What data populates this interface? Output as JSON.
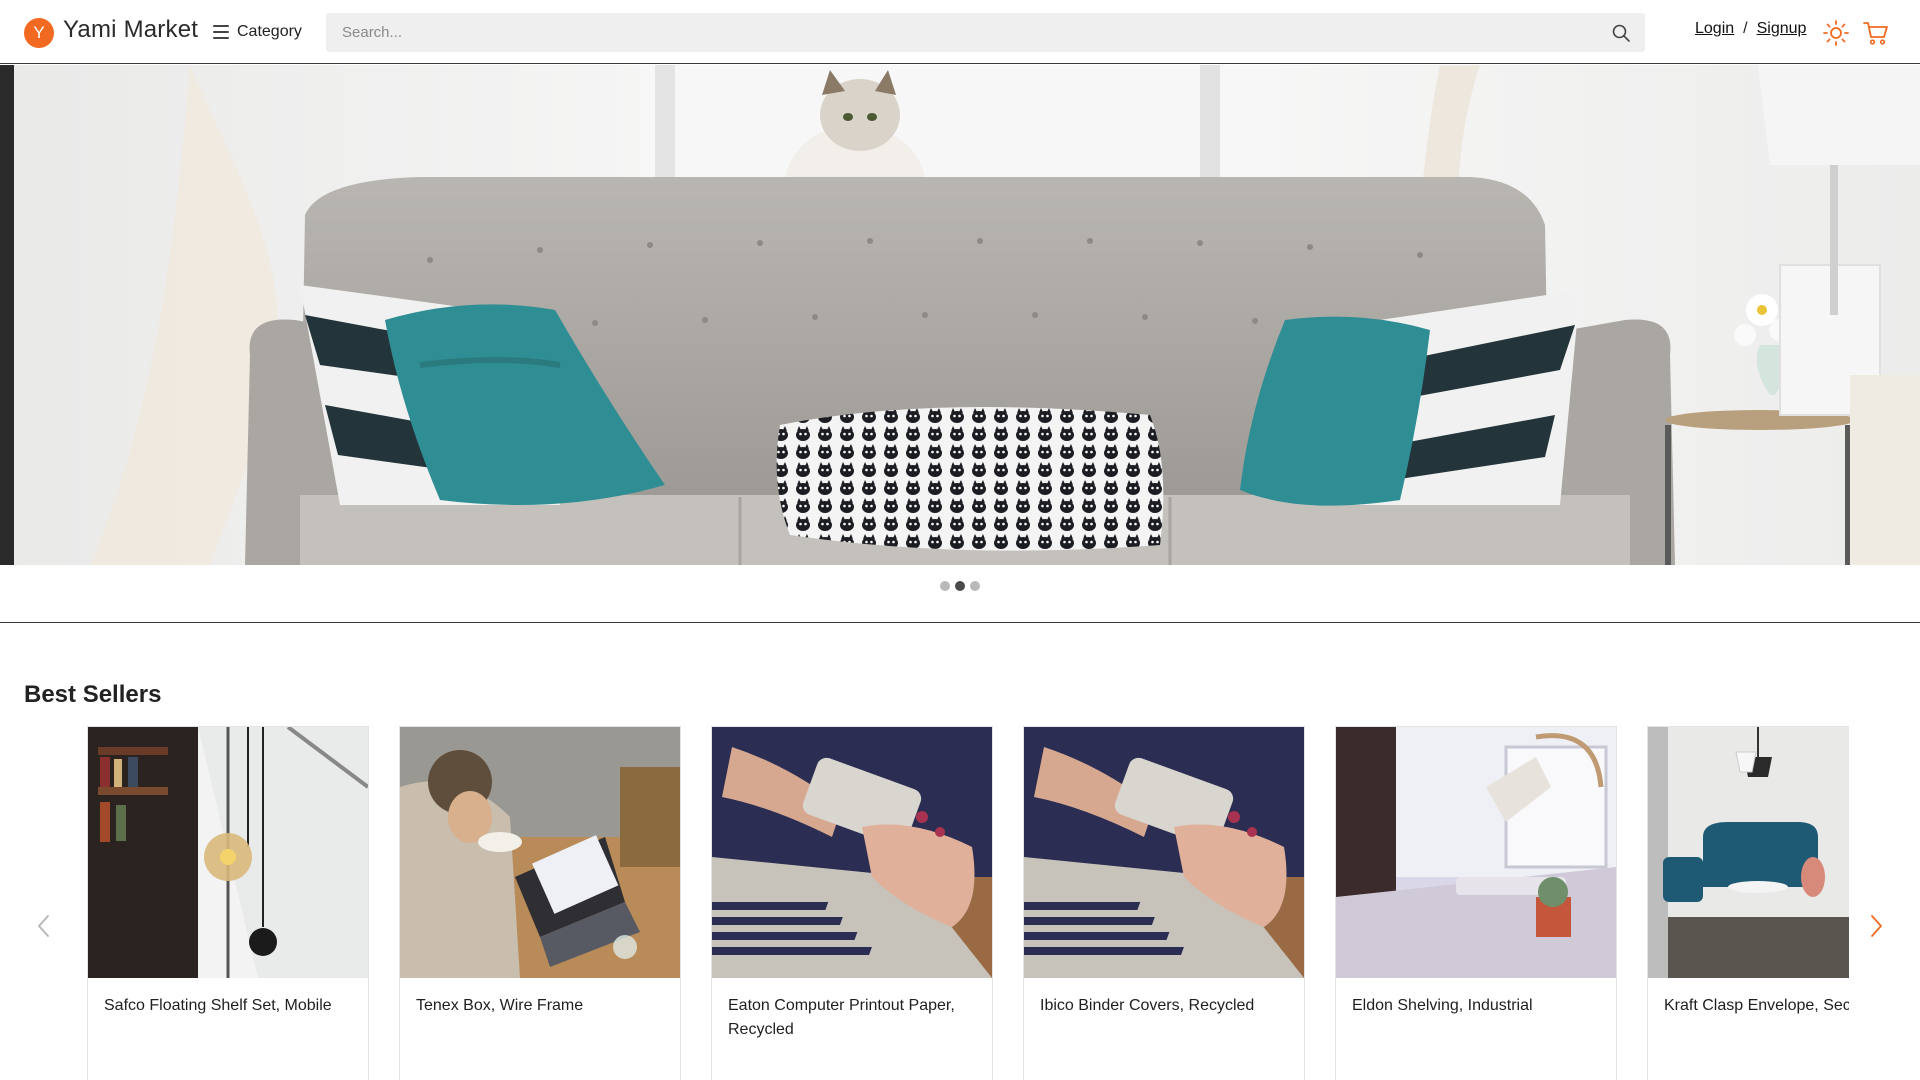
{
  "header": {
    "logo_letter": "Y",
    "brand": "Yami Market",
    "category_label": "Category",
    "search_placeholder": "Search...",
    "login_label": "Login",
    "separator": "/",
    "signup_label": "Signup",
    "icons": {
      "logo": "logo-badge",
      "category": "hamburger-menu-icon",
      "search": "search-icon",
      "theme": "sun-icon",
      "cart": "cart-icon"
    },
    "colors": {
      "accent": "#f26a21"
    }
  },
  "hero": {
    "image": "living room with grey tufted sofa, teal and striped pillows, cat in window",
    "slides": 3,
    "active_slide": 2
  },
  "best_sellers": {
    "title": "Best Sellers",
    "prev_icon": "chevron-left-icon",
    "next_icon": "chevron-right-icon",
    "products": [
      {
        "name": "Safco Floating Shelf Set, Mobile"
      },
      {
        "name": "Tenex Box, Wire Frame"
      },
      {
        "name": "Eaton Computer Printout Paper, Recycled"
      },
      {
        "name": "Ibico Binder Covers, Recycled"
      },
      {
        "name": "Eldon Shelving, Industrial"
      },
      {
        "name": "Kraft Clasp Envelope, Sec Tint"
      }
    ]
  }
}
